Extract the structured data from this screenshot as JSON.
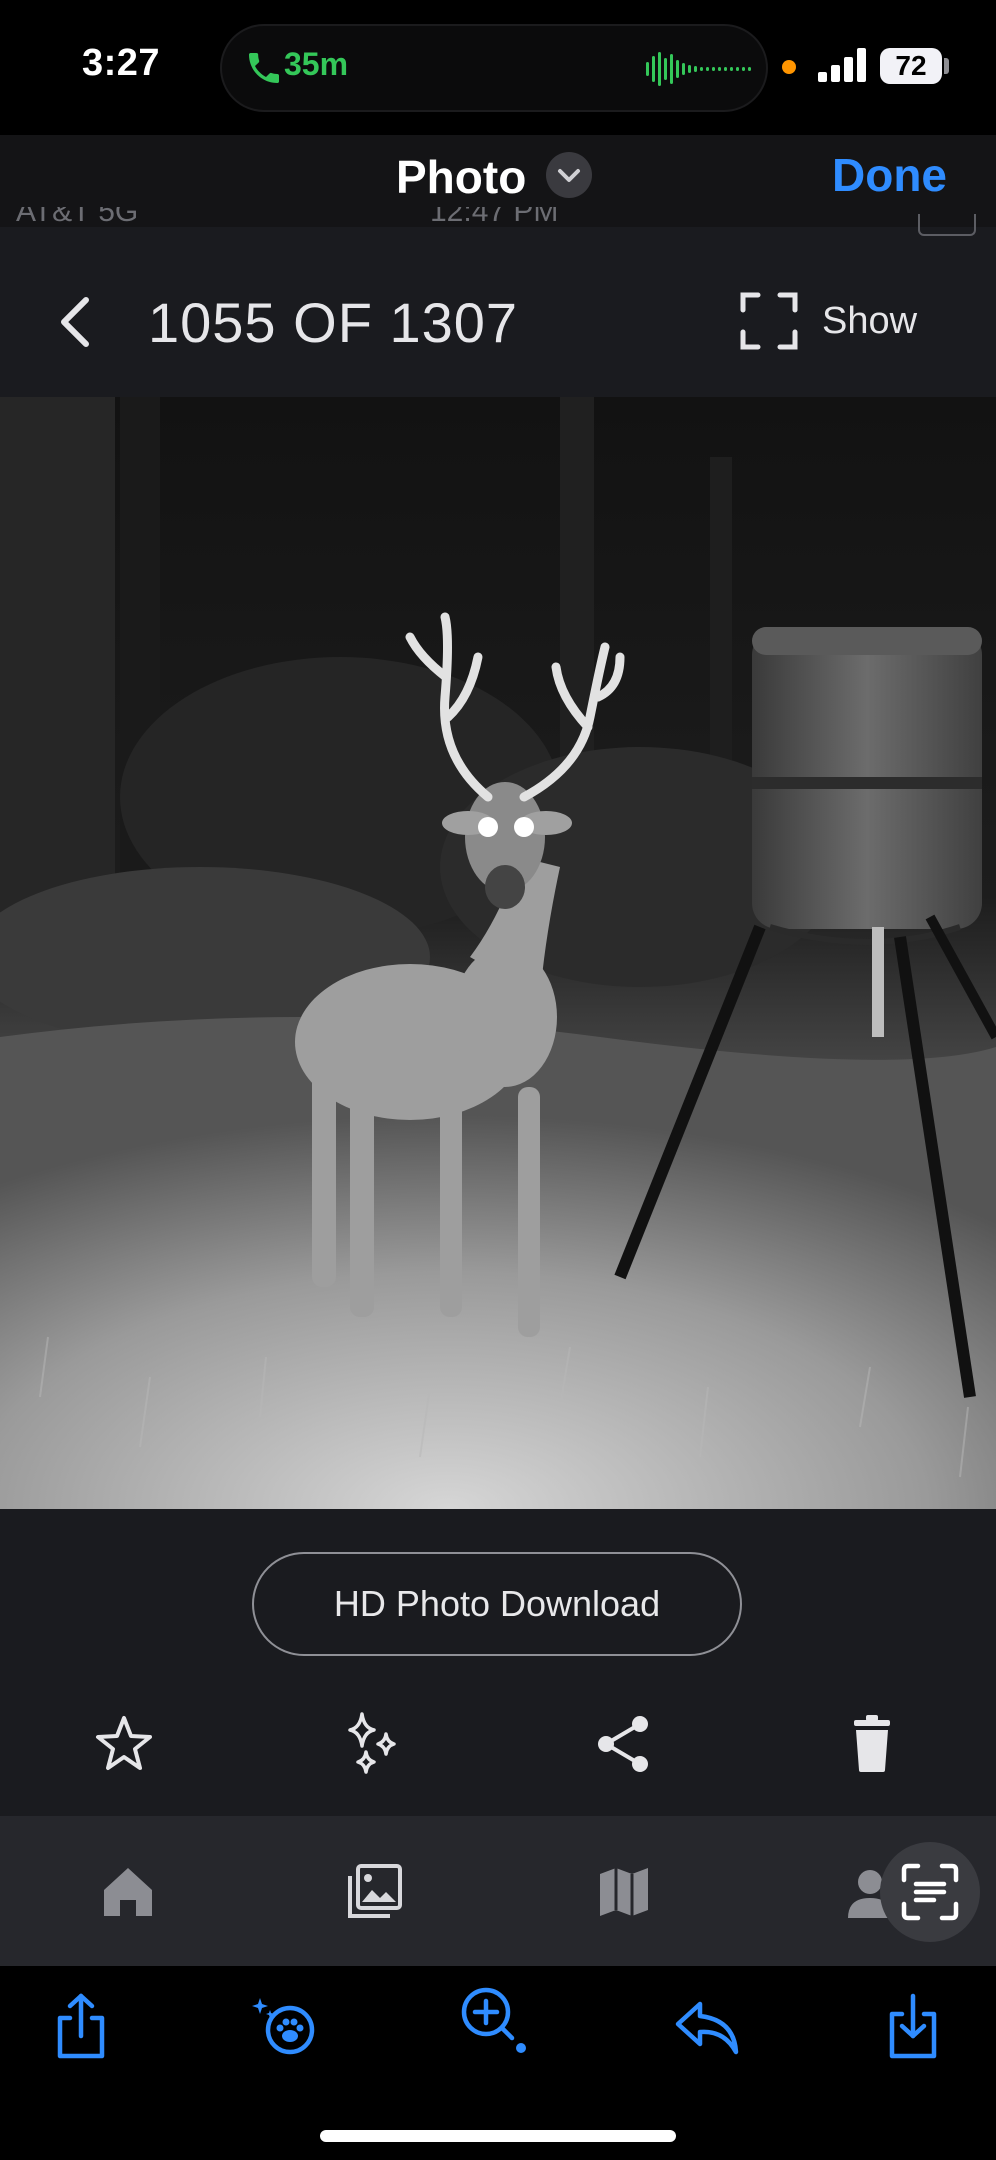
{
  "status_bar": {
    "time": "3:27",
    "call_duration": "35m",
    "battery": "72"
  },
  "sheet": {
    "title": "Photo",
    "done_label": "Done"
  },
  "content": {
    "previous_status_left": "AT&T 5G",
    "previous_status_time": "12:47 PM",
    "counter": "1055 OF 1307",
    "show_label": "Show",
    "hd_download_label": "HD Photo Download",
    "actions": [
      "star-icon",
      "sparkles-icon",
      "share-icon",
      "trash-icon"
    ],
    "tabs": [
      "home-icon",
      "gallery-icon",
      "map-icon",
      "profile-icon"
    ]
  },
  "toolbar": {
    "items": [
      "share-icon",
      "visual-lookup-icon",
      "zoom-in-icon",
      "reply-icon",
      "download-icon"
    ]
  },
  "colors": {
    "accent_blue": "#2f8cff",
    "call_green": "#34c759",
    "mic_orange": "#ff9500"
  }
}
